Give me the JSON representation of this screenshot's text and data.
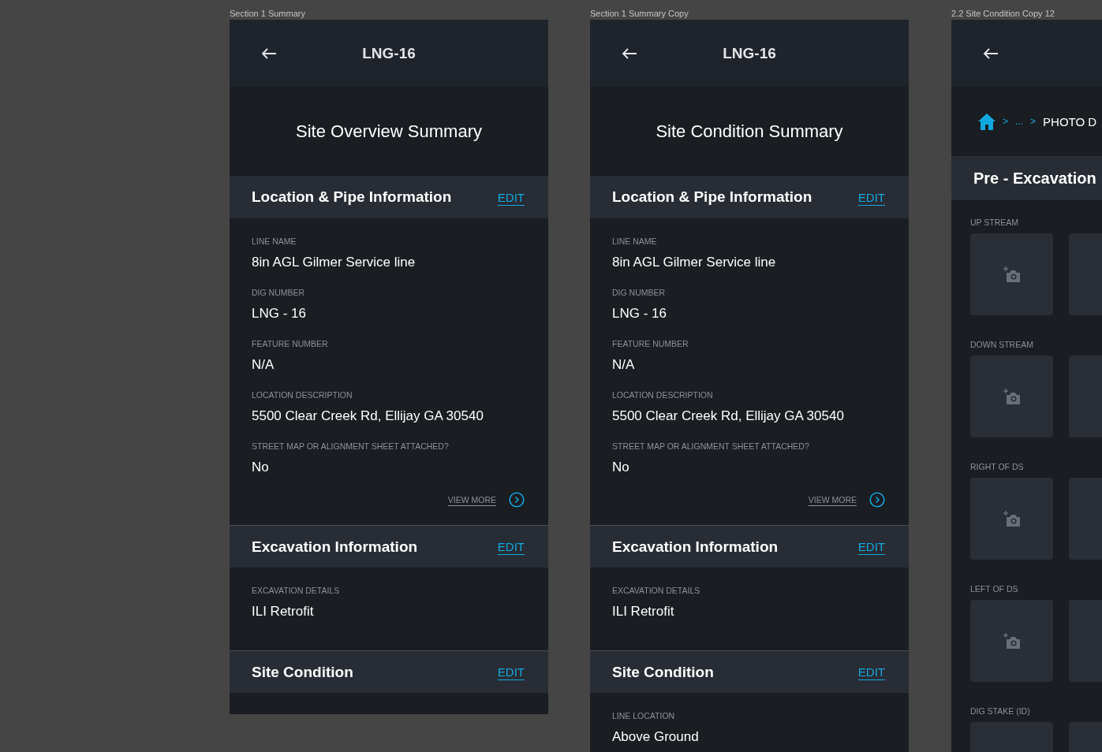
{
  "artboards": [
    {
      "label": "Section 1 Summary",
      "title": "LNG-16",
      "heading": "Site Overview Summary",
      "sections": [
        {
          "title": "Location & Pipe Information",
          "edit": "EDIT",
          "fields": [
            {
              "label": "LINE NAME",
              "value": "8in AGL Gilmer Service line"
            },
            {
              "label": "DIG NUMBER",
              "value": "LNG - 16"
            },
            {
              "label": "FEATURE NUMBER",
              "value": "N/A"
            },
            {
              "label": "LOCATION DESCRIPTION",
              "value": "5500 Clear Creek Rd, Ellijay GA 30540"
            },
            {
              "label": "STREET MAP OR ALIGNMENT SHEET ATTACHED?",
              "value": "No"
            }
          ],
          "view_more": "VIEW MORE"
        },
        {
          "title": "Excavation Information",
          "edit": "EDIT",
          "fields": [
            {
              "label": "EXCAVATION DETAILS",
              "value": "ILI Retrofit"
            }
          ]
        },
        {
          "title": "Site Condition",
          "edit": "EDIT"
        }
      ]
    },
    {
      "label": "Section 1 Summary Copy",
      "title": "LNG-16",
      "heading": "Site Condition Summary",
      "sections": [
        {
          "title": "Location & Pipe Information",
          "edit": "EDIT",
          "fields": [
            {
              "label": "LINE NAME",
              "value": "8in AGL Gilmer Service line"
            },
            {
              "label": "DIG NUMBER",
              "value": "LNG - 16"
            },
            {
              "label": "FEATURE NUMBER",
              "value": "N/A"
            },
            {
              "label": "LOCATION DESCRIPTION",
              "value": "5500 Clear Creek Rd, Ellijay GA 30540"
            },
            {
              "label": "STREET MAP OR ALIGNMENT SHEET ATTACHED?",
              "value": "No"
            }
          ],
          "view_more": "VIEW MORE"
        },
        {
          "title": "Excavation Information",
          "edit": "EDIT",
          "fields": [
            {
              "label": "EXCAVATION DETAILS",
              "value": "ILI Retrofit"
            }
          ]
        },
        {
          "title": "Site Condition",
          "edit": "EDIT",
          "fields": [
            {
              "label": "LINE LOCATION",
              "value": "Above Ground"
            }
          ]
        }
      ]
    }
  ],
  "photo_artboard": {
    "label": "2.2 Site Condition Copy 12",
    "breadcrumb": [
      ">",
      "...",
      ">",
      "PHOTO D"
    ],
    "section_title": "Pre - Excavation",
    "groups": [
      {
        "label": "UP STREAM"
      },
      {
        "label": "DOWN STREAM"
      },
      {
        "label": "RIGHT OF DS"
      },
      {
        "label": "LEFT OF DS"
      },
      {
        "label": "DIG STAKE (ID)"
      }
    ]
  }
}
